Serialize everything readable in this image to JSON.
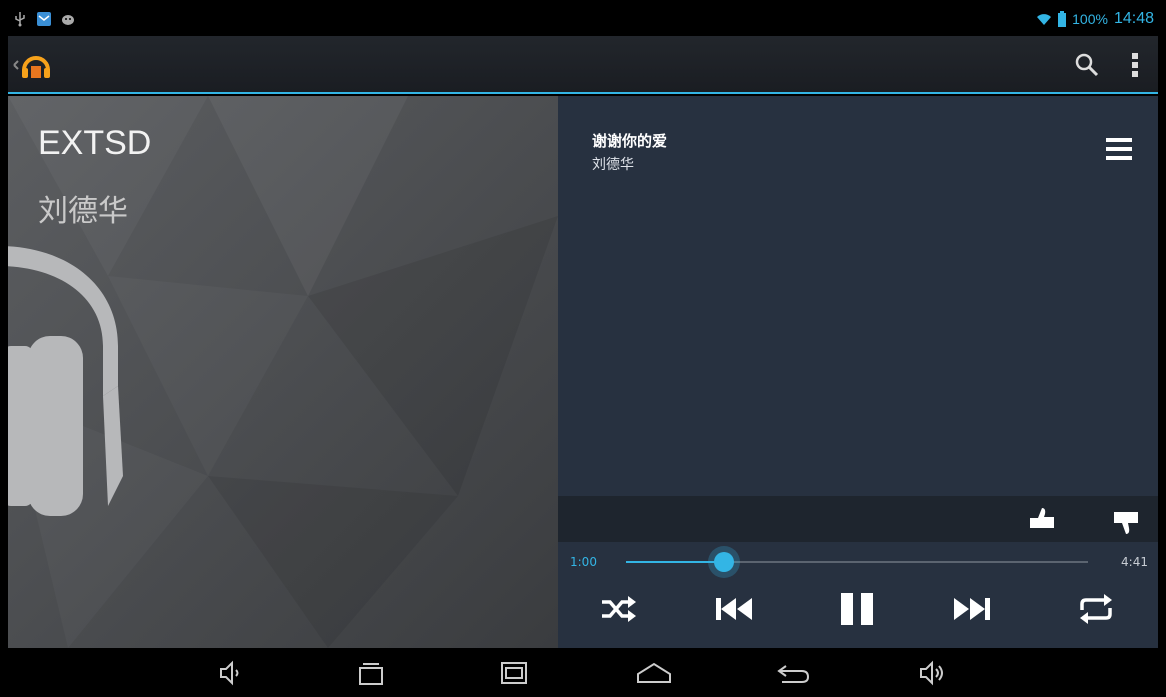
{
  "status_bar": {
    "battery_percent": "100%",
    "time": "14:48",
    "icons": [
      "usb-icon",
      "mail-icon",
      "android-debug-icon",
      "wifi-icon",
      "battery-icon"
    ]
  },
  "action_bar": {
    "icons": [
      "app-headphones-icon",
      "search-icon",
      "overflow-menu-icon"
    ]
  },
  "album": {
    "title": "EXTSD",
    "artist": "刘德华"
  },
  "now_playing": {
    "song_title": "谢谢你的爱",
    "song_artist": "刘德华",
    "elapsed": "1:00",
    "duration": "4:41",
    "progress": 0.213
  },
  "colors": {
    "accent": "#33b5e5",
    "panel": "#273140",
    "rating_bar": "#1e252e"
  },
  "controls": [
    "shuffle-icon",
    "previous-icon",
    "pause-icon",
    "next-icon",
    "repeat-icon"
  ],
  "nav_bar": [
    "volume-down-icon",
    "recent-apps-icon",
    "screenshot-icon",
    "home-icon",
    "back-icon",
    "volume-up-icon"
  ]
}
